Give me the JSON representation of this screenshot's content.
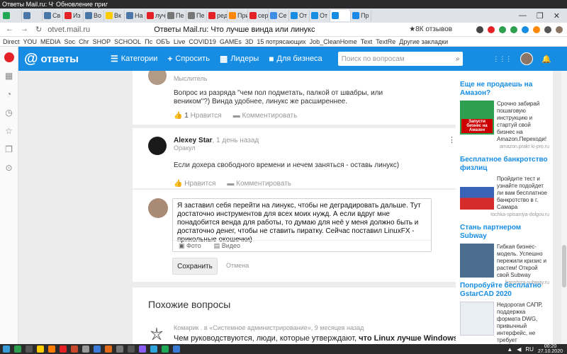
{
  "taskbar_top": {
    "window_title_1": "Ответы Mail.ru: Что ...",
    "window_title_2": "Обновление прило..."
  },
  "tabs": [
    {
      "label": "",
      "color": "#1fa855"
    },
    {
      "label": "",
      "color": "#4a76a8"
    },
    {
      "label": "Св",
      "color": "#4a76a8"
    },
    {
      "label": "Из",
      "color": "#e32127"
    },
    {
      "label": "Во",
      "color": "#4a76a8"
    },
    {
      "label": "Вк",
      "color": "#ffcc00"
    },
    {
      "label": "На",
      "color": "#4a76a8"
    },
    {
      "label": "луч",
      "color": "#e32127"
    },
    {
      "label": "Пе",
      "color": "#777777"
    },
    {
      "label": "Пе",
      "color": "#777777"
    },
    {
      "label": "ред",
      "color": "#e32127"
    },
    {
      "label": "При",
      "color": "#ff8800"
    },
    {
      "label": "сер",
      "color": "#e32127"
    },
    {
      "label": "Се",
      "color": "#3d8ee6"
    },
    {
      "label": "От",
      "color": "#168de2"
    },
    {
      "label": "От",
      "color": "#168de2"
    },
    {
      "label": "",
      "color": "#168de2"
    },
    {
      "label": "Пр",
      "color": "#1c87e5"
    }
  ],
  "window_controls": {
    "minimize": "—",
    "maximize": "❐",
    "close": "✕"
  },
  "address": {
    "url": "otvet.mail.ru",
    "title": "Ответы Mail.ru: Что лучше винда или линукс",
    "reviews": "★8К отзывов"
  },
  "bookmarks": [
    "Direct",
    "YOU",
    "MEDIA",
    "Soc",
    "Chr",
    "SHOP",
    "SCHOOL",
    "Пс",
    "ОБЪ",
    "Live",
    "COVID19",
    "GAMEs",
    "3D",
    "15 потрясающих",
    "Job_CleanHome",
    "Text",
    "TextRe",
    "Другие закладки"
  ],
  "header": {
    "logo_text": "ответы",
    "nav": [
      {
        "icon": "☰",
        "label": "Категории"
      },
      {
        "icon": "+",
        "label": "Спросить"
      },
      {
        "icon": "▦",
        "label": "Лидеры"
      },
      {
        "icon": "■",
        "label": "Для бизнеса"
      }
    ],
    "search_placeholder": "Поиск по вопросам",
    "icons": {
      "apps": "⋮⋮⋮",
      "bell": "🔔"
    }
  },
  "answers": [
    {
      "username": "",
      "time": "",
      "rank": "Мыслитель",
      "text": "Вопрос из разряда \"чем пол подметать, палкой от швабры, или веником\"?) Винда удобнее, линукс же расширеннее.",
      "likes": "1",
      "like_label": "Нравится",
      "comment_label": "Комментировать"
    },
    {
      "username": "Alexey Star",
      "time": "1 день назад",
      "rank": "Оракул",
      "text": "Если дохера свободного времени и нечем заняться - оставь линукс)",
      "likes": "",
      "like_label": "Нравится",
      "comment_label": "Комментировать"
    }
  ],
  "reply": {
    "text": "Я заставил себя перейти на линукс, чтобы не деградировать дальше. Тут достаточно инструментов для всех моих нужд. А если вдруг мне понадобится венда для работы, то думаю для неё у меня должно быть и достаточно денег, чтобы не ставить пиратку. Сейчас поставил LinuxFX - прикольные окошечки)",
    "photo_label": "Фото",
    "video_label": "Видео",
    "save_label": "Сохранить",
    "cancel_label": "Отмена"
  },
  "similar": {
    "heading": "Похожие вопросы",
    "meta": "Комарик . в «Системное администрирование», 9 месяцев назад",
    "question_pre": "Чем руководствуются, люди, которые утверждают, ",
    "question_bold": "что Linux лучше Windows",
    "question_post": "?"
  },
  "ads": [
    {
      "title": "Еще не продаешь на Амазон?",
      "text": "Срочно забирай пошаговую инструкцию и стартуй свой бизнес на Amazon.Переходи!",
      "source": "amazon.prakt ki-pro.ru",
      "img_label": "Запусти бизнес на Амазон",
      "img_color": "#2e9e4f"
    },
    {
      "title": "Бесплатное банкротство физлиц",
      "text": "Пройдите тест и узнайте подойдет ли вам бесплатное банкротство в г. Самара",
      "source": "tochka-spisaniya-dolgov.ru",
      "img_label": "",
      "img_color": "#8fa6c9"
    },
    {
      "title": "Стань партнером Subway",
      "text": "Гибкая бизнес-модель. Успешно пережили кризис и растем! Открой свой Subway",
      "source": "franshiza-subway.ru",
      "img_label": "",
      "img_color": "#4b6e8e"
    },
    {
      "title": "Попробуйте бесплатно GstarCAD 2020",
      "text": "Недорогая САПР, поддержка формата DWG, привычный интерфейс, не требует переобучения.",
      "source": "",
      "img_label": "",
      "img_color": "#e9eef3"
    }
  ],
  "tray": {
    "lang": "RU",
    "time": "00:20",
    "date": "27.10.2020"
  }
}
